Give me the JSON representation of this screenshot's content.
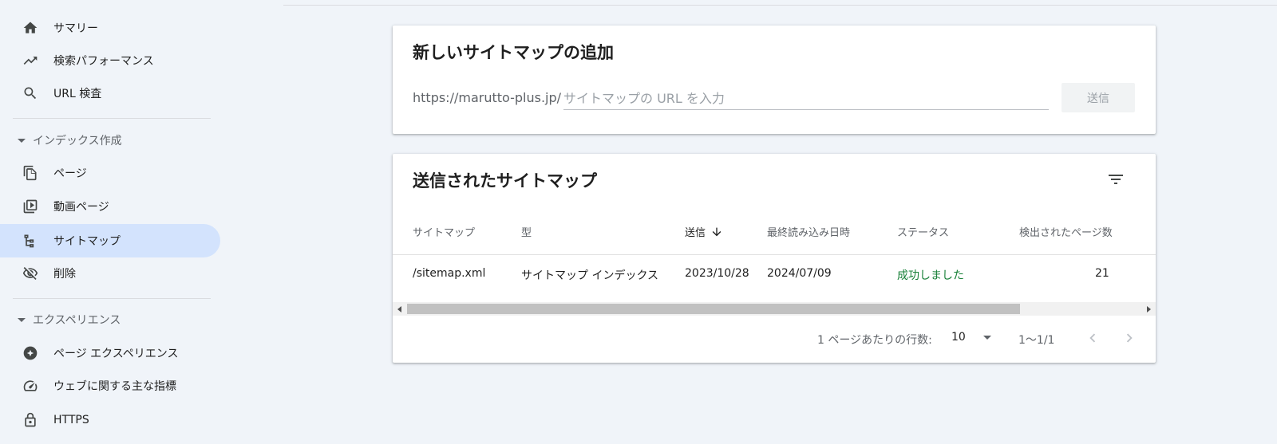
{
  "sidebar": {
    "items_top": [
      {
        "label": "サマリー",
        "icon": "home-icon"
      },
      {
        "label": "検索パフォーマンス",
        "icon": "trending-up-icon"
      },
      {
        "label": "URL 検査",
        "icon": "search-icon"
      }
    ],
    "index_section": {
      "label": "インデックス作成"
    },
    "index_items": [
      {
        "label": "ページ",
        "icon": "pages-icon"
      },
      {
        "label": "動画ページ",
        "icon": "video-pages-icon"
      },
      {
        "label": "サイトマップ",
        "icon": "sitemap-icon",
        "active": true
      },
      {
        "label": "削除",
        "icon": "removal-icon"
      }
    ],
    "experience_section": {
      "label": "エクスペリエンス"
    },
    "experience_items": [
      {
        "label": "ページ エクスペリエンス",
        "icon": "page-experience-icon"
      },
      {
        "label": "ウェブに関する主な指標",
        "icon": "gauge-icon"
      },
      {
        "label": "HTTPS",
        "icon": "lock-icon"
      }
    ],
    "active_color": "#d3e3fd"
  },
  "add_sitemap": {
    "title": "新しいサイトマップの追加",
    "url_prefix": "https://marutto-plus.jp/",
    "input_placeholder": "サイトマップの URL を入力",
    "input_value": "",
    "submit_label": "送信"
  },
  "submitted": {
    "title": "送信されたサイトマップ",
    "columns": [
      "サイトマップ",
      "型",
      "送信",
      "最終読み込み日時",
      "ステータス",
      "検出されたページ数"
    ],
    "sorted_column": "送信",
    "rows": [
      {
        "sitemap": "/sitemap.xml",
        "type": "サイトマップ インデックス",
        "submitted": "2023/10/28",
        "last_read": "2024/07/09",
        "status": "成功しました",
        "pages": "21"
      }
    ],
    "status_color": "#188038",
    "pager": {
      "rows_per_page_label": "1 ページあたりの行数:",
      "rows_per_page": "10",
      "range": "1〜1/1"
    }
  }
}
